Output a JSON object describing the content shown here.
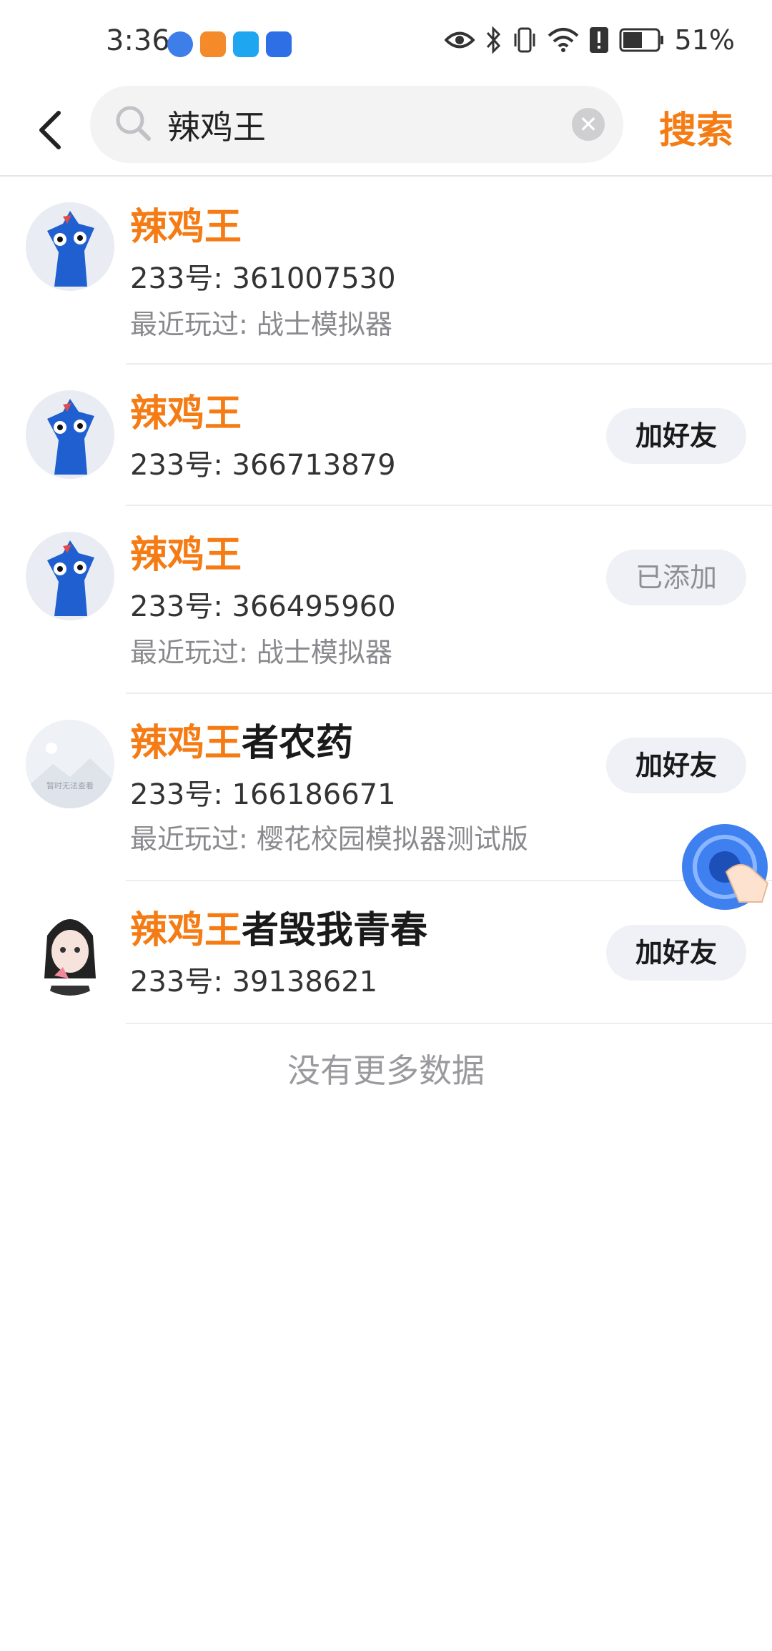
{
  "status_bar": {
    "time": "3:36",
    "battery": "51%",
    "icons": [
      "eye-icon",
      "bluetooth-icon",
      "vibrate-icon",
      "wifi-icon",
      "alert-icon",
      "battery-icon"
    ],
    "app_icons": [
      "notify-app-icon-1",
      "notify-app-icon-2",
      "notify-app-icon-3",
      "notify-app-icon-4"
    ]
  },
  "header": {
    "search_value": "辣鸡王",
    "search_button": "搜索"
  },
  "colors": {
    "accent": "#f57c14",
    "button_bg": "#eff1f6"
  },
  "results": [
    {
      "name_highlight": "辣鸡王",
      "name_rest": "",
      "uid": "233号: 361007530",
      "recent": "最近玩过: 战士模拟器",
      "action": ""
    },
    {
      "name_highlight": "辣鸡王",
      "name_rest": "",
      "uid": "233号: 366713879",
      "recent": "",
      "action": "加好友"
    },
    {
      "name_highlight": "辣鸡王",
      "name_rest": "",
      "uid": "233号: 366495960",
      "recent": "最近玩过: 战士模拟器",
      "action": "已添加"
    },
    {
      "name_highlight": "辣鸡王",
      "name_rest": "者农药",
      "uid": "233号: 166186671",
      "recent": "最近玩过: 樱花校园模拟器测试版",
      "action": "加好友",
      "avatar_placeholder": "暂时无法查看"
    },
    {
      "name_highlight": "辣鸡王",
      "name_rest": "者毁我青春",
      "uid": "233号: 39138621",
      "recent": "",
      "action": "加好友"
    }
  ],
  "footer": {
    "no_more": "没有更多数据"
  }
}
